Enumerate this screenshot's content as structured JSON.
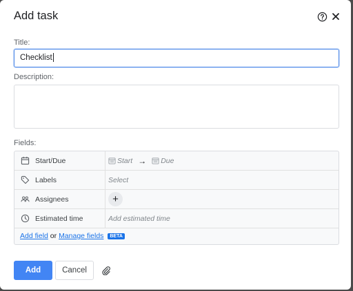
{
  "dialog": {
    "title": "Add task",
    "help_icon": "help-circle-icon",
    "close_icon": "close-icon"
  },
  "title_field": {
    "label": "Title:",
    "value": "Checklist"
  },
  "description_field": {
    "label": "Description:",
    "value": ""
  },
  "fields_section": {
    "label": "Fields:",
    "rows": [
      {
        "name": "Start/Due",
        "icon": "calendar-icon",
        "start_placeholder": "Start",
        "due_placeholder": "Due"
      },
      {
        "name": "Labels",
        "icon": "tag-icon",
        "placeholder": "Select"
      },
      {
        "name": "Assignees",
        "icon": "people-icon",
        "add_icon": "plus-icon"
      },
      {
        "name": "Estimated time",
        "icon": "clock-icon",
        "placeholder": "Add estimated time"
      }
    ],
    "add_field_link": "Add field",
    "or_text": "or",
    "manage_fields_link": "Manage fields",
    "beta_badge": "BETA"
  },
  "footer": {
    "add_label": "Add",
    "cancel_label": "Cancel",
    "attach_icon": "paperclip-icon"
  },
  "colors": {
    "primary": "#4285f4",
    "link": "#1a73e8",
    "focus_border": "#4a86e8"
  }
}
